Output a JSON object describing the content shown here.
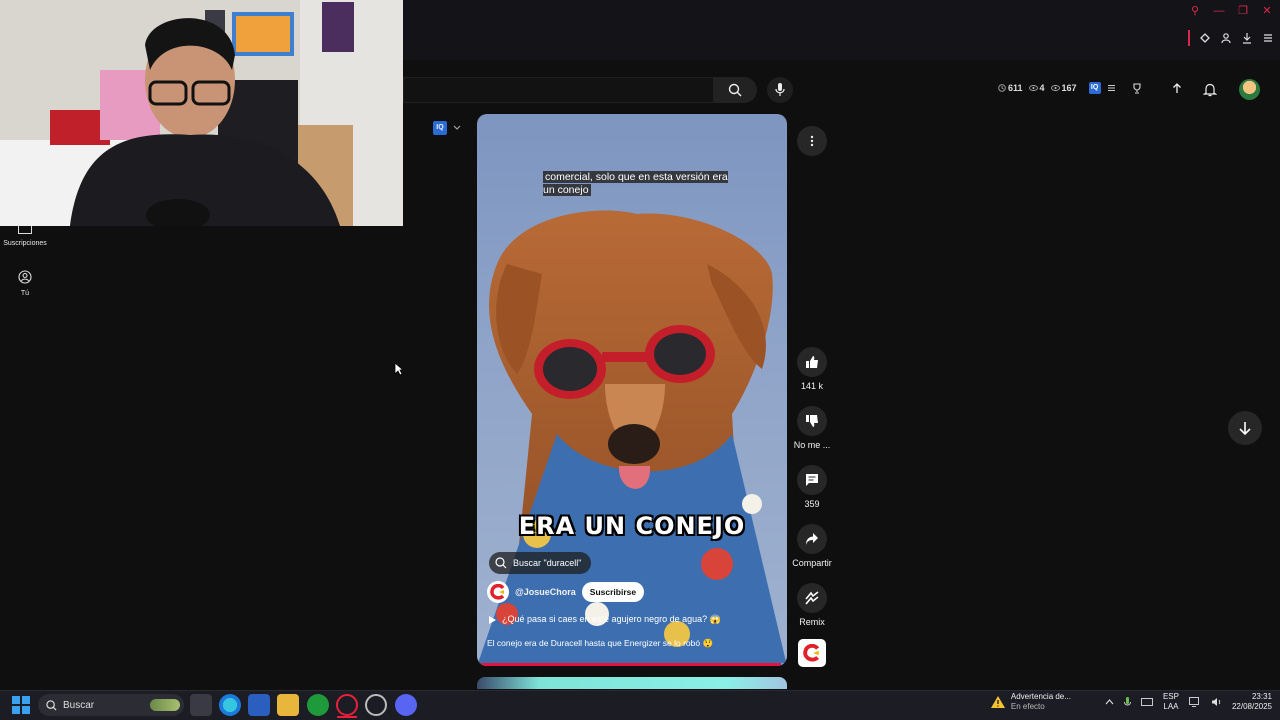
{
  "header": {
    "stats": {
      "clock_count": "611",
      "eye_count_1": "4",
      "eye_count_2": "167"
    },
    "iq_badge": "IQ"
  },
  "sidebar": {
    "items": [
      {
        "label": "Suscripciones",
        "icon": "subscriptions-icon"
      },
      {
        "label": "Tú",
        "icon": "you-icon"
      }
    ]
  },
  "short": {
    "caption_top": "comercial, solo que en esta versión era un conejo",
    "big_caption": "ERA UN CONEJO",
    "search_chip": "Buscar \"duracell\"",
    "channel": "@JosueChora",
    "subscribe_label": "Suscribirse",
    "song": "¿Qué pasa si caes en este agujero negro de agua? 😱",
    "description": "El conejo era de Duracell hasta que Energizer se lo robó 😲",
    "progress": 0.98,
    "iq_label": "IQ"
  },
  "actions": {
    "like_count": "141 k",
    "dislike_label": "No me ...",
    "comments_count": "359",
    "share_label": "Compartir",
    "remix_label": "Remix"
  },
  "taskbar": {
    "search_placeholder": "Buscar",
    "warning_title": "Advertencia de...",
    "warning_sub": "En efecto",
    "lang_top": "ESP",
    "lang_bottom": "LAA",
    "time": "23:31",
    "date": "22/08/2025"
  },
  "colors": {
    "accent": "#e8113b",
    "background": "#0f0f0f",
    "chip": "#272727"
  }
}
